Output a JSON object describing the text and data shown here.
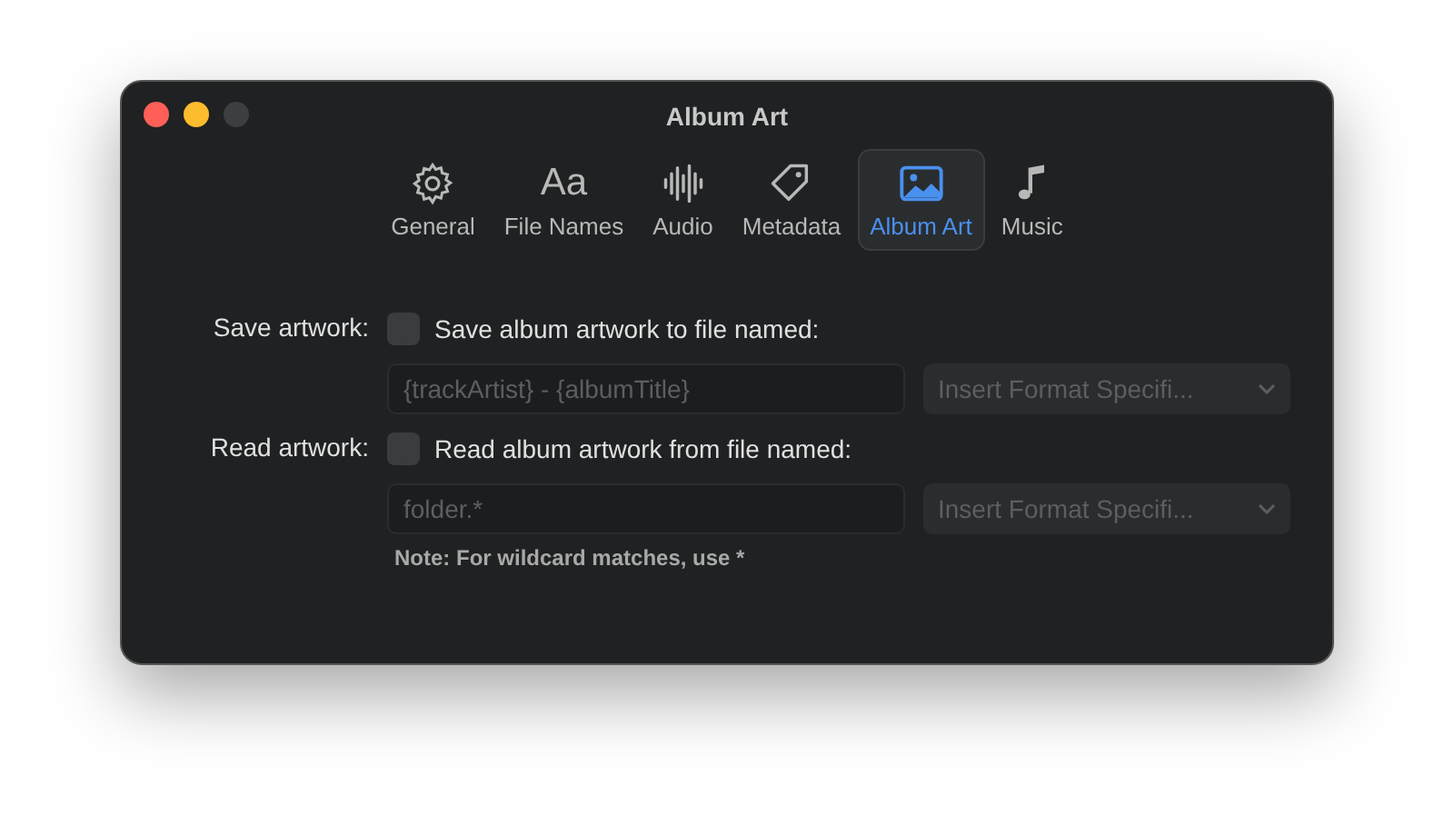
{
  "window": {
    "title": "Album Art"
  },
  "tabs": [
    {
      "label": "General",
      "kind": "gear",
      "selected": false
    },
    {
      "label": "File Names",
      "kind": "glyph",
      "glyph": "Aa",
      "selected": false
    },
    {
      "label": "Audio",
      "kind": "wave",
      "selected": false
    },
    {
      "label": "Metadata",
      "kind": "tag",
      "selected": false
    },
    {
      "label": "Album Art",
      "kind": "image",
      "selected": true
    },
    {
      "label": "Music",
      "kind": "note",
      "selected": false
    }
  ],
  "sections": [
    {
      "label": "Save artwork:",
      "checkbox": {
        "label": "Save album artwork to file named:",
        "checked": false
      },
      "field": {
        "value": "{trackArtist} - {albumTitle}",
        "disabled": true
      },
      "popup": {
        "value": "Insert Format Specifi...",
        "disabled": true
      }
    },
    {
      "label": "Read artwork:",
      "checkbox": {
        "label": "Read album artwork from file named:",
        "checked": false
      },
      "field": {
        "value": "folder.*",
        "disabled": true
      },
      "popup": {
        "value": "Insert Format Specifi...",
        "disabled": true
      }
    }
  ],
  "note": "Note: For wildcard matches, use *"
}
